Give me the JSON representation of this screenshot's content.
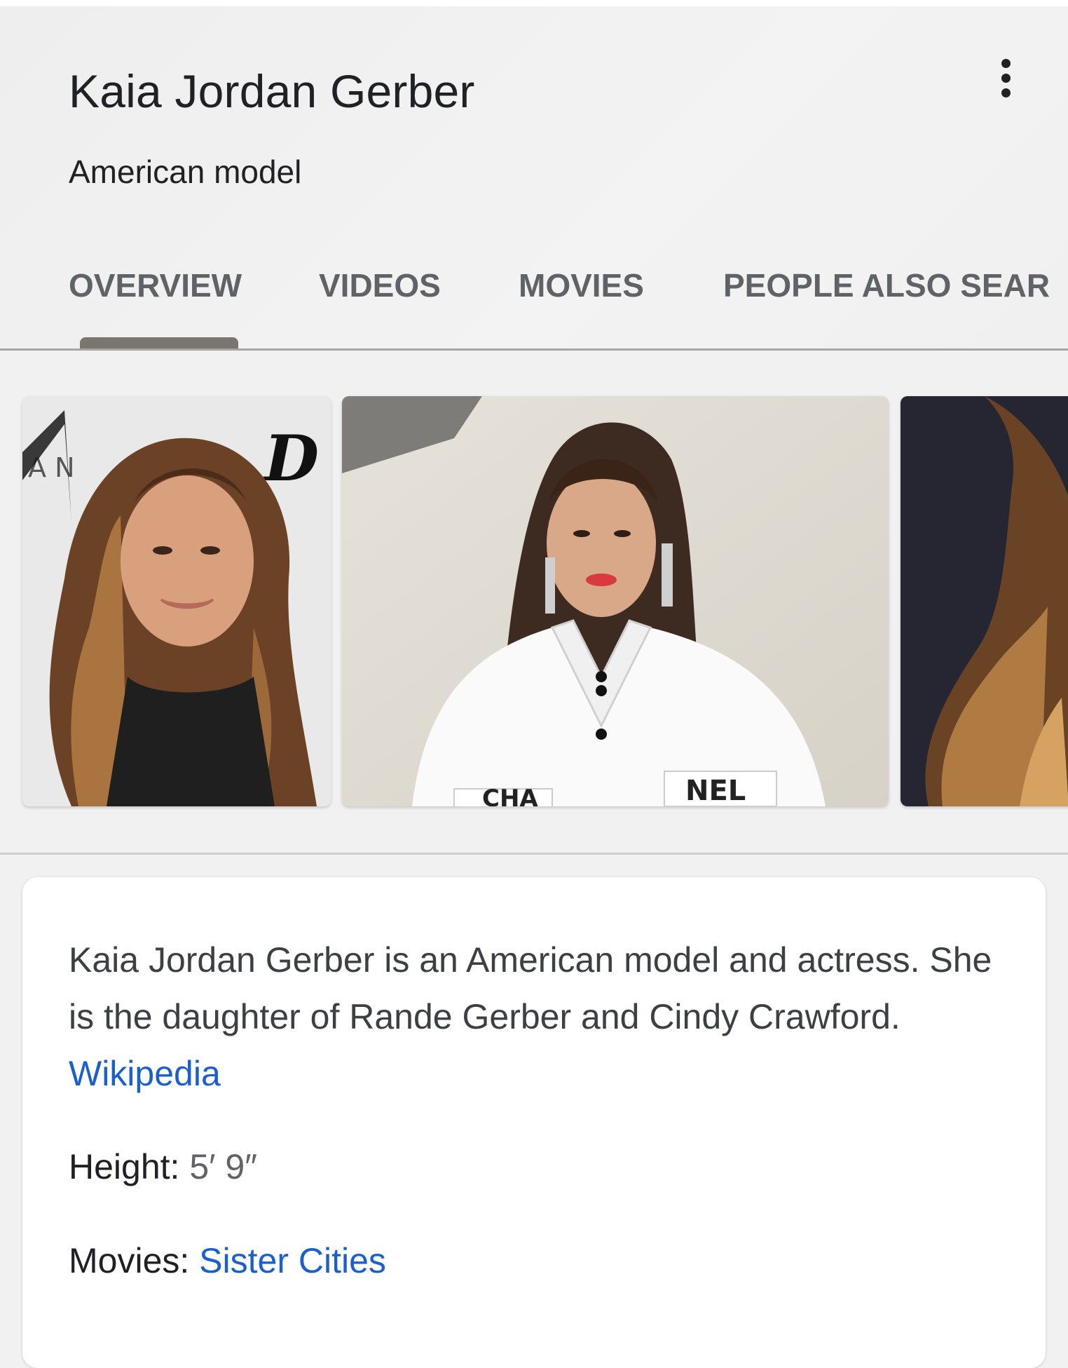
{
  "header": {
    "title": "Kaia Jordan Gerber",
    "subtitle": "American model",
    "more_icon": "more-vert-icon"
  },
  "tabs": [
    {
      "label": "OVERVIEW",
      "selected": true
    },
    {
      "label": "VIDEOS",
      "selected": false
    },
    {
      "label": "MOVIES",
      "selected": false
    },
    {
      "label": "PEOPLE ALSO SEAR",
      "selected": false
    }
  ],
  "photos": {
    "second": {
      "tag_left": "CHA",
      "tag_right": "NEL"
    }
  },
  "card": {
    "description": "Kaia Jordan Gerber is an American model and actress. She is the daughter of Rande Gerber and Cindy Crawford.",
    "source_link": "Wikipedia",
    "facts": [
      {
        "label": "Height:",
        "value": "5′ 9″"
      },
      {
        "label": "Movies:",
        "value": "Sister Cities"
      }
    ]
  },
  "colors": {
    "link": "#1a5fd0",
    "text_primary": "#202124",
    "text_secondary": "#5f6368",
    "tab_indicator": "#7b7570"
  }
}
